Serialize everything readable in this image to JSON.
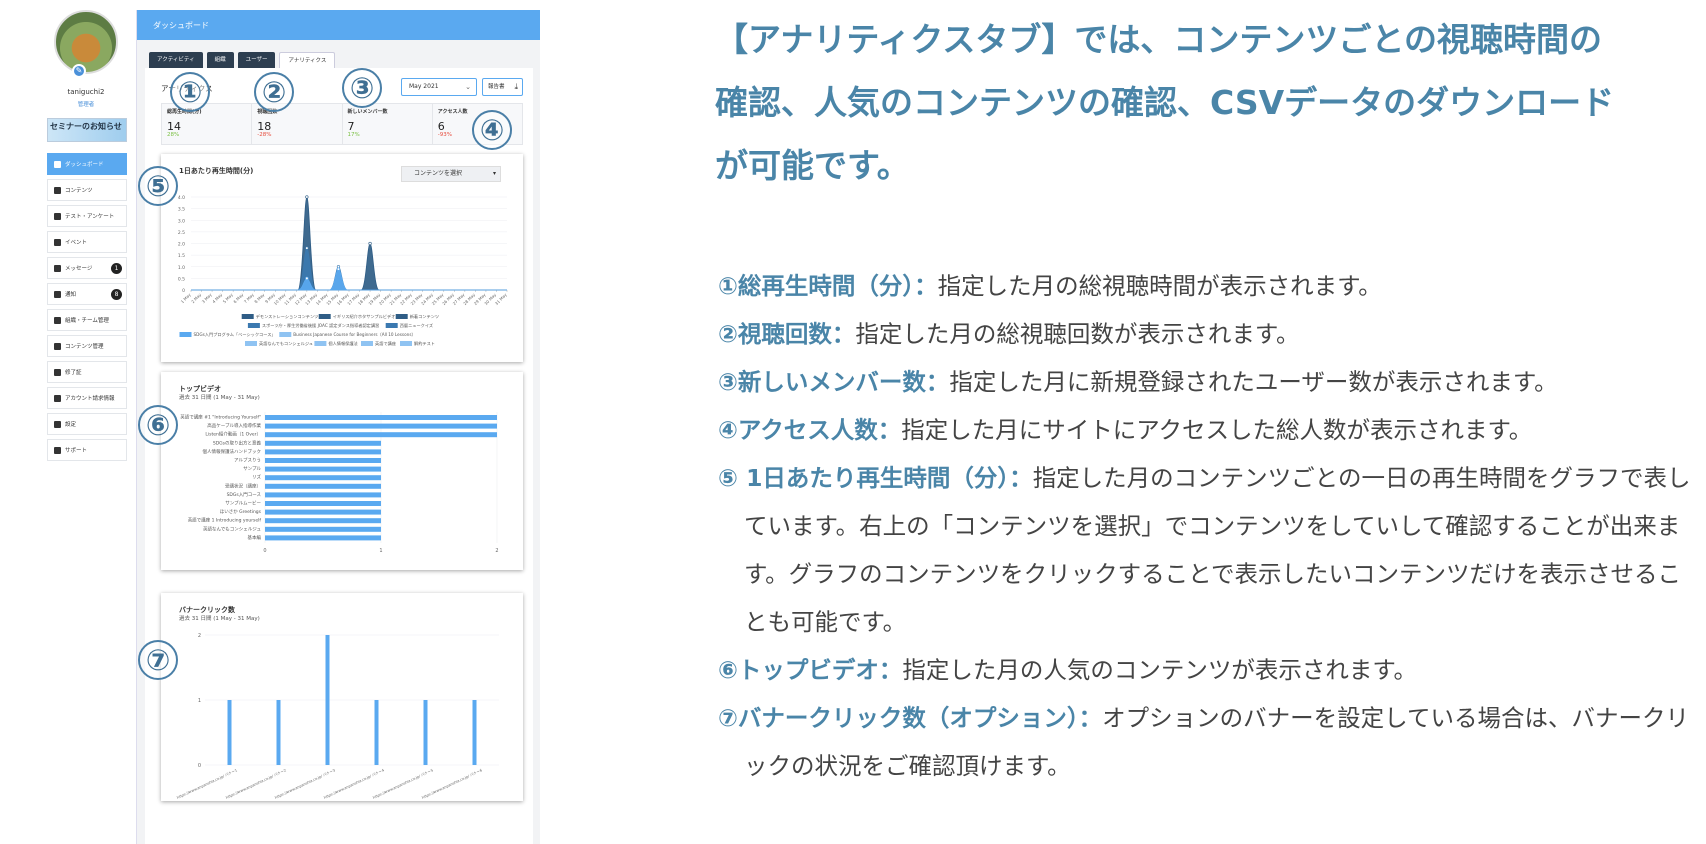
{
  "sidebar": {
    "username": "taniguchi2",
    "role": "管理者",
    "seminar_banner": "セミナーのお知らせ",
    "items": [
      {
        "label": "ダッシュボード",
        "icon": "dashboard-icon",
        "active": true,
        "badge": ""
      },
      {
        "label": "コンテンツ",
        "icon": "book-icon",
        "active": false,
        "badge": ""
      },
      {
        "label": "テスト・アンケート",
        "icon": "clipboard-icon",
        "active": false,
        "badge": ""
      },
      {
        "label": "イベント",
        "icon": "megaphone-icon",
        "active": false,
        "badge": ""
      },
      {
        "label": "メッセージ",
        "icon": "chat-icon",
        "active": false,
        "badge": "1"
      },
      {
        "label": "通知",
        "icon": "bell-icon",
        "active": false,
        "badge": "8"
      },
      {
        "label": "組織・チーム管理",
        "icon": "team-icon",
        "active": false,
        "badge": ""
      },
      {
        "label": "コンテンツ管理",
        "icon": "content-admin-icon",
        "active": false,
        "badge": ""
      },
      {
        "label": "修了証",
        "icon": "certificate-icon",
        "active": false,
        "badge": ""
      },
      {
        "label": "アカウント請求情報",
        "icon": "billing-icon",
        "active": false,
        "badge": ""
      },
      {
        "label": "設定",
        "icon": "gear-icon",
        "active": false,
        "badge": ""
      },
      {
        "label": "サポート",
        "icon": "info-icon",
        "active": false,
        "badge": ""
      }
    ]
  },
  "app": {
    "header": "ダッシュボード",
    "tabs": [
      {
        "label": "アクティビティ",
        "active": false
      },
      {
        "label": "組織",
        "active": false
      },
      {
        "label": "ユーザー",
        "active": false
      },
      {
        "label": "アナリティクス",
        "active": true
      }
    ],
    "analytics_title": "アナリティクス",
    "month": "May 2021",
    "report_label": "報告書",
    "stats": [
      {
        "label": "総再生時間(分)",
        "value": "14",
        "change": "28%",
        "trend": "up"
      },
      {
        "label": "視聴回数",
        "value": "18",
        "change": "-28%",
        "trend": "down"
      },
      {
        "label": "新しいメンバー数",
        "value": "7",
        "change": "17%",
        "trend": "up"
      },
      {
        "label": "アクセス人数",
        "value": "6",
        "change": "-93%",
        "trend": "down"
      }
    ],
    "daily_title": "1日あたり再生時間(分)",
    "content_select": "コンテンツを選択",
    "top_title": "トップビデオ",
    "top_sub": "過去 31 日間 (1 May - 31 May)",
    "banner_title": "バナークリック数",
    "banner_sub": "過去 31 日間 (1 May - 31 May)"
  },
  "chart_data": [
    {
      "type": "area",
      "title": "1日あたり再生時間(分)",
      "x": [
        "1 May",
        "2 May",
        "3 May",
        "4 May",
        "5 May",
        "6 May",
        "7 May",
        "8 May",
        "9 May",
        "10 May",
        "11 May",
        "12 May",
        "13 May",
        "14 May",
        "15 May",
        "16 May",
        "17 May",
        "18 May",
        "19 May",
        "20 May",
        "21 May",
        "22 May",
        "23 May",
        "24 May",
        "25 May",
        "26 May",
        "27 May",
        "28 May",
        "29 May",
        "30 May",
        "31 May"
      ],
      "ylim": [
        0,
        4.0
      ],
      "yticks": [
        "4.0",
        "3.5",
        "3.0",
        "2.5",
        "2.0",
        "1.5",
        "1.0",
        "0.5",
        "0"
      ],
      "series": [
        {
          "name": "デモンストレーションコンテンツ",
          "color": "#2f5d86",
          "values": [
            0,
            0,
            0,
            0,
            0,
            0,
            0,
            0,
            0,
            0,
            0,
            4.0,
            0,
            0,
            0,
            0,
            0,
            2.0,
            0,
            0,
            0,
            0,
            0,
            0,
            0,
            0,
            0,
            0,
            0,
            0,
            0
          ]
        },
        {
          "name": "スポーツ庁・厚生労働省後援 JOAC 認定ダンス指導者認定講習",
          "color": "#3b79b0",
          "values": [
            0,
            0,
            0,
            0,
            0,
            0,
            0,
            0,
            0,
            0,
            0,
            1.8,
            0,
            0,
            1.0,
            0,
            0,
            0,
            0,
            0,
            0,
            0,
            0,
            0,
            0,
            0,
            0,
            0,
            0,
            0,
            0
          ]
        },
        {
          "name": "SDGs入門プログラム「ベーシックコース」",
          "color": "#5aa9f0",
          "values": [
            0,
            0,
            0,
            0,
            0,
            0,
            0,
            0,
            0,
            0,
            0,
            0.5,
            0,
            0,
            0.9,
            0,
            0,
            0,
            0,
            0,
            0,
            0,
            0,
            0,
            0,
            0,
            0,
            0,
            0,
            0,
            0
          ]
        }
      ],
      "legend": [
        {
          "name": "デモンストレーションコンテンツ",
          "color": "#2f5d86"
        },
        {
          "name": "イギリス紹介ホタサンプルビデオ",
          "color": "#2f5d86"
        },
        {
          "name": "新着コンテンツ",
          "color": "#2f5d86"
        },
        {
          "name": "スポーツ庁・厚生労働省後援 JOAC 認定ダンス指導者認定講習",
          "color": "#3b79b0"
        },
        {
          "name": "西暦ニュークイズ",
          "color": "#3b79b0"
        },
        {
          "name": "SDGs入門プログラム「ベーシックコース」",
          "color": "#5aa9f0"
        },
        {
          "name": "Business Japanese Course for Beginners（All 10 Lessons）",
          "color": "#8fc3f2"
        },
        {
          "name": "英語なんでもコンシェルジュ",
          "color": "#8fc3f2"
        },
        {
          "name": "個人情報保護法",
          "color": "#8fc3f2"
        },
        {
          "name": "英語で講座",
          "color": "#8fc3f2"
        },
        {
          "name": "解約テスト",
          "color": "#8fc3f2"
        }
      ]
    },
    {
      "type": "bar",
      "orientation": "horizontal",
      "title": "トップビデオ",
      "categories": [
        "英語で講座 #1 \"Introducing Yourself\"",
        "高品ケーブル導入指導作業",
        "Listen紹介動画（1 Over）",
        "SDGsの取り出方と意義",
        "個人情報保護法ハンドブック",
        "アルプスりう",
        "サンプル",
        "リズ",
        "受講状況（講座）",
        "SDGs入門コース",
        "サンプルムービー",
        "ほいさか Greetings",
        "英語で講座 1 Introducing yourself",
        "英語なんでもコンシェルジュ",
        "基本編"
      ],
      "values": [
        2,
        2,
        2,
        1,
        1,
        1,
        1,
        1,
        1,
        1,
        1,
        1,
        1,
        1,
        1
      ],
      "xlim": [
        0,
        2
      ],
      "xticks": [
        "0",
        "1",
        "2"
      ]
    },
    {
      "type": "bar",
      "title": "バナークリック数",
      "categories": [
        "https://www.anpanshia.co.jp/ バナー1",
        "https://www.anpanshia.co.jp/ バナー2",
        "https://www.anpanshia.co.jp/ バナー3",
        "https://www.anpanshia.co.jp/ バナー4",
        "https://www.anpanshia.co.jp/ バナー5",
        "https://www.anpanshia.co.jp/ バナー6"
      ],
      "values": [
        1,
        1,
        2,
        1,
        1,
        1
      ],
      "ylim": [
        0,
        2
      ],
      "yticks": [
        "2",
        "1",
        "0"
      ]
    }
  ],
  "markers": [
    "①",
    "②",
    "③",
    "④",
    "⑤",
    "⑥",
    "⑦"
  ],
  "heading": [
    "【アナリティクスタブ】では、コンテンツごとの視聴時間の",
    "確認、人気のコンテンツの確認、CSVデータのダウンロード",
    "が可能です。"
  ],
  "descriptions": [
    {
      "term": "①総再生時間（分）：",
      "text": "指定した月の総視聴時間が表示されます。"
    },
    {
      "term": "②視聴回数：",
      "text": "指定した月の総視聴回数が表示されます。"
    },
    {
      "term": "③新しいメンバー数：",
      "text": "指定した月に新規登録されたユーザー数が表示されます。"
    },
    {
      "term": "④アクセス人数：",
      "text": "指定した月にサイトにアクセスした総人数が表示されます。"
    },
    {
      "term": "⑤ 1日あたり再生時間（分）：",
      "text": "指定した月のコンテンツごとの一日の再生時間をグラフで表しています。右上の「コンテンツを選択」でコンテンツをしていして確認することが出来ます。グラフのコンテンツをクリックすることで表示したいコンテンツだけを表示させることも可能です。"
    },
    {
      "term": "⑥トップビデオ：",
      "text": "指定した月の人気のコンテンツが表示されます。"
    },
    {
      "term": "⑦バナークリック数（オプション）：",
      "text": "オプションのバナーを設定している場合は、バナークリックの状況をご確認頂けます。"
    }
  ]
}
